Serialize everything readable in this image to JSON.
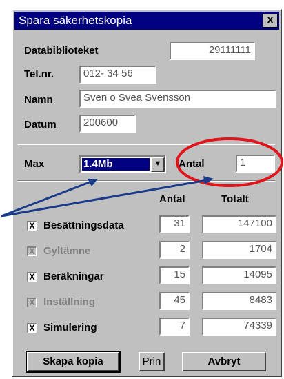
{
  "window": {
    "title": "Spara säkerhetskopia",
    "close_label": "X"
  },
  "form": {
    "databibliotek_label": "Databiblioteket",
    "databibliotek_value": "29111111",
    "tel_label": "Tel.nr.",
    "tel_value": "012- 34 56",
    "namn_label": "Namn",
    "namn_value": "Sven o Svea Svensson",
    "datum_label": "Datum",
    "datum_value": "200600",
    "max_label": "Max",
    "max_value": "1.4Mb",
    "antal_label": "Antal",
    "antal_value": "1"
  },
  "table": {
    "col_antal": "Antal",
    "col_totalt": "Totalt",
    "rows": [
      {
        "label": "Besättningsdata",
        "checked": "X",
        "enabled": true,
        "antal": "31",
        "totalt": "147100"
      },
      {
        "label": "Gyltämne",
        "checked": "X",
        "enabled": false,
        "antal": "2",
        "totalt": "1704"
      },
      {
        "label": "Beräkningar",
        "checked": "X",
        "enabled": true,
        "antal": "15",
        "totalt": "14095"
      },
      {
        "label": "Inställning",
        "checked": "X",
        "enabled": false,
        "antal": "45",
        "totalt": "8483"
      },
      {
        "label": "Simulering",
        "checked": "X",
        "enabled": true,
        "antal": "7",
        "totalt": "74339"
      }
    ]
  },
  "buttons": {
    "create": "Skapa kopia",
    "print": "Prin",
    "cancel": "Avbryt"
  },
  "colors": {
    "annotation_ellipse": "#e0151b",
    "annotation_arrow": "#1a3a8a",
    "title_bar": "#000080"
  }
}
